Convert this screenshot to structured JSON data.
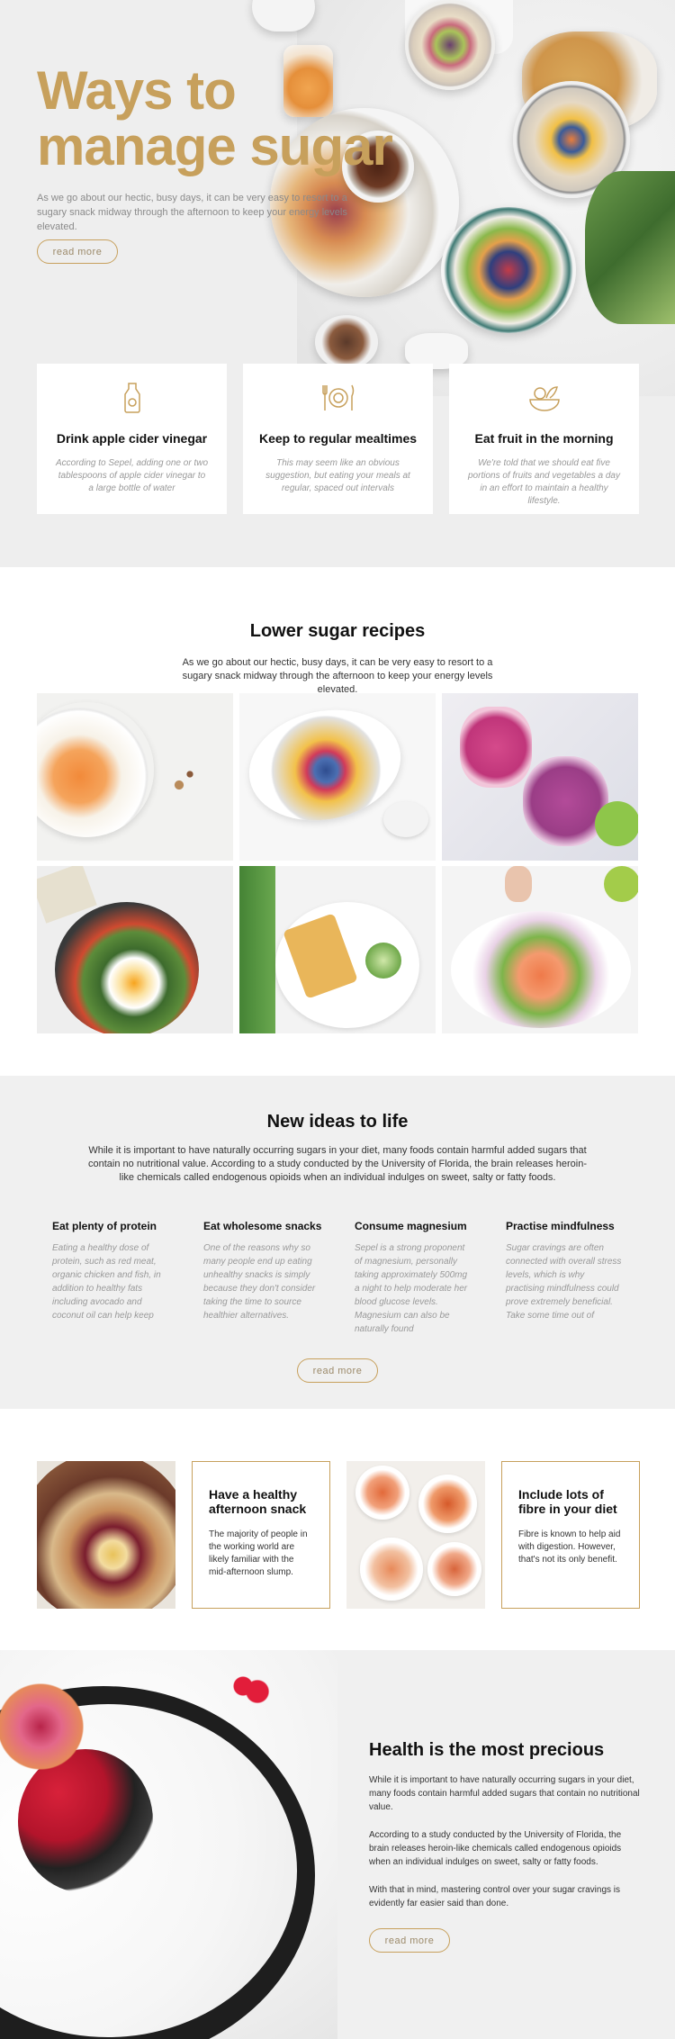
{
  "hero": {
    "title_line1": "Ways to",
    "title_line2": "manage sugar",
    "text": "As we go about our hectic, busy days, it can be very easy to resort to a sugary snack midway through the afternoon to keep your energy levels elevated.",
    "button": "read more"
  },
  "features": [
    {
      "icon": "bottle-icon",
      "title": "Drink apple cider vinegar",
      "text": "According to Sepel, adding one or two tablespoons of apple cider vinegar to a large bottle of water"
    },
    {
      "icon": "plate-cutlery-icon",
      "title": "Keep to regular mealtimes",
      "text": "This may seem like an obvious suggestion, but eating your meals at regular, spaced out intervals"
    },
    {
      "icon": "fruit-bowl-icon",
      "title": "Eat fruit in the morning",
      "text": "We're told that we should eat five portions of fruits and vegetables a day in an effort to maintain a healthy lifestyle."
    }
  ],
  "recipes": {
    "title": "Lower sugar recipes",
    "subtitle": "As we go about our hectic, busy days, it can be very easy to resort to a sugary snack midway through the afternoon to keep your energy levels elevated."
  },
  "ideas": {
    "title": "New ideas to life",
    "intro": "While it is important to have naturally occurring sugars in your diet, many foods contain harmful added sugars that contain no nutritional value.  According to a study conducted by the University of Florida, the brain releases heroin-like chemicals called endogenous opioids when an individual indulges on sweet, salty or fatty foods.",
    "items": [
      {
        "title": "Eat plenty of protein",
        "text": "Eating a healthy dose of protein, such as red meat, organic chicken and fish, in addition to healthy fats including avocado and coconut oil can help keep"
      },
      {
        "title": "Eat wholesome snacks",
        "text": "One of the reasons why so many people end up eating unhealthy snacks is simply because they don't consider taking the time to source healthier alternatives."
      },
      {
        "title": "Consume magnesium",
        "text": "Sepel is a strong proponent of magnesium, personally taking approximately 500mg a night to help moderate her blood glucose levels. Magnesium can also be naturally found"
      },
      {
        "title": "Practise mindfulness",
        "text": "Sugar cravings are often connected with overall stress levels, which is why practising mindfulness could prove extremely beneficial. Take some time out of"
      }
    ],
    "button": "read more"
  },
  "cards": [
    {
      "title": "Have a healthy afternoon snack",
      "text": "The majority of people in the working world are likely familiar with the mid-afternoon slump."
    },
    {
      "title": "Include lots of fibre in your diet",
      "text": "Fibre is known to help aid with digestion. However, that's not its only benefit."
    }
  ],
  "health": {
    "title": "Health is the most precious",
    "p1": "While it is important to have naturally occurring sugars in your diet, many foods contain harmful added sugars that contain no nutritional value.",
    "p2": "According to a study conducted by the University of Florida, the brain releases heroin-like chemicals called endogenous opioids when an individual indulges on sweet, salty or fatty foods.",
    "p3": "With that in mind, mastering control over your sugar cravings is evidently far easier said than done.",
    "button": "read more"
  },
  "colors": {
    "accent": "#c7a05c",
    "panel": "#f0f0f0"
  }
}
